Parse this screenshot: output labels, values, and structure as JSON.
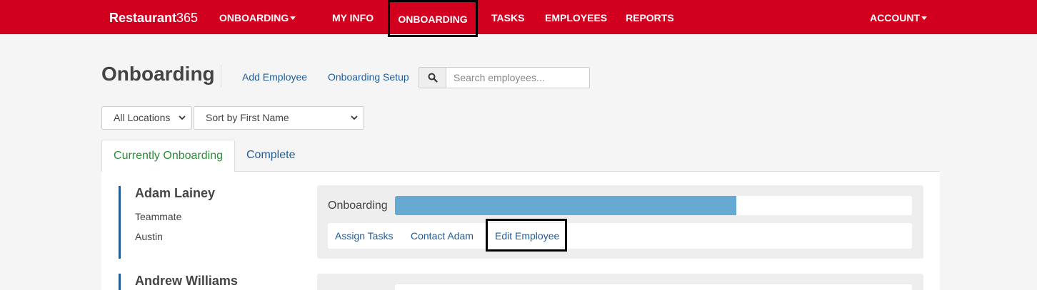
{
  "nav": {
    "brand_main": "Restaurant",
    "brand_num": "365",
    "app_menu": "ONBOARDING",
    "items": [
      "MY INFO",
      "ONBOARDING",
      "TASKS",
      "EMPLOYEES",
      "REPORTS"
    ],
    "account": "ACCOUNT"
  },
  "header": {
    "title": "Onboarding",
    "add_employee": "Add Employee",
    "setup": "Onboarding Setup",
    "search_placeholder": "Search employees..."
  },
  "filters": {
    "location": "All Locations",
    "sort": "Sort by First Name"
  },
  "tabs": [
    "Currently Onboarding",
    "Complete"
  ],
  "employees": [
    {
      "name": "Adam Lainey",
      "role": "Teammate",
      "location": "Austin",
      "progress_label": "Onboarding",
      "progress": 0.66,
      "actions": [
        "Assign Tasks",
        "Contact Adam",
        "Edit Employee"
      ]
    },
    {
      "name": "Andrew Williams"
    }
  ],
  "colors": {
    "brand_red": "#d2001e",
    "link_blue": "#1f5c99",
    "active_tab_green": "#2e8b3a",
    "progress_blue": "#66aad4"
  }
}
